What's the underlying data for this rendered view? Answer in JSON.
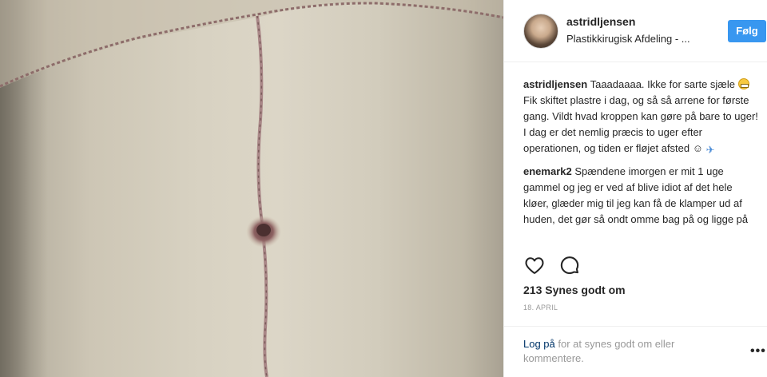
{
  "post": {
    "image_alt": "Post photo: abdomen with surgical scars",
    "username": "astridljensen",
    "location": "Plastikkirugisk Afdeling - ...",
    "follow_label": "Følg"
  },
  "comments": [
    {
      "author": "astridljensen",
      "text_1": "Taaadaaaa. Ikke for sarte sjæle",
      "text_2": "Fik skiftet plastre i dag, og så så arrene for første gang. Vildt hvad kroppen kan gøre på bare to uger! I dag er det nemlig præcis to uger efter operationen, og tiden er fløjet afsted",
      "text_3": "☺"
    },
    {
      "author": "enemark2",
      "text": "Spændene imorgen er mit 1 uge gammel og jeg er ved af blive idiot af det hele kløer, glæder mig til jeg kan få de klamper ud af huden, det gør så ondt omme bag på og ligge på"
    }
  ],
  "actions": {
    "like_icon": "heart-icon",
    "comment_icon": "comment-icon"
  },
  "likes_text": "213 Synes godt om",
  "date_text": "18. APRIL",
  "footer": {
    "login_link": "Log på",
    "login_rest": "for at synes godt om eller kommentere.",
    "more_label": "•••"
  }
}
